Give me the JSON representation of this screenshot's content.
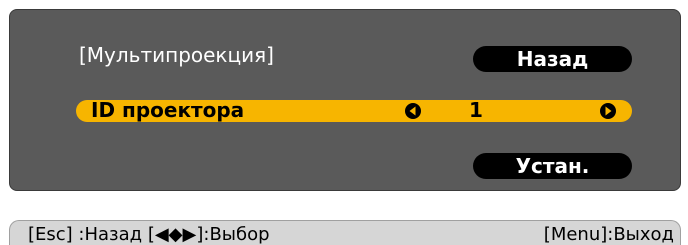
{
  "menu": {
    "title": "[Мультипроекция]",
    "back_label": "Назад",
    "setting": {
      "label": "ID проектора",
      "value": "1"
    },
    "set_label": "Устан."
  },
  "help": {
    "left_text": "[Esc] :Назад  [◀◆▶]:Выбор",
    "right_text": "[Menu]:Выход"
  },
  "icons": {
    "decrease": "arrow-left-icon",
    "increase": "arrow-right-icon"
  },
  "colors": {
    "panel": "#5a5a5a",
    "highlight": "#f7b500",
    "button": "#000000",
    "help_bar": "#d6d6d6"
  }
}
